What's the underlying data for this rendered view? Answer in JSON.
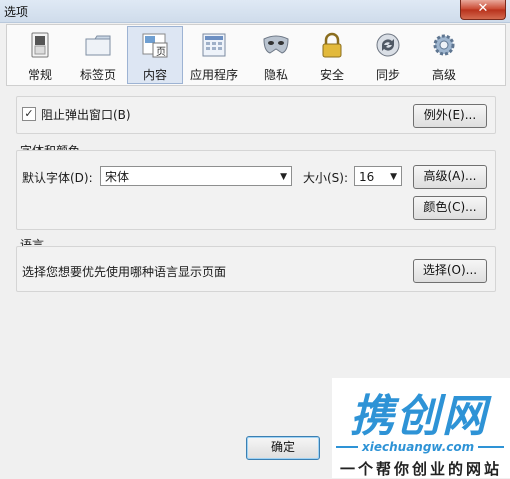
{
  "window": {
    "title": "选项",
    "close_label": "✕"
  },
  "tabs": [
    {
      "label": "常规",
      "icon": "switch-icon"
    },
    {
      "label": "标签页",
      "icon": "folder-tab-icon"
    },
    {
      "label": "内容",
      "icon": "page-content-icon",
      "active": true,
      "icon_text": "页"
    },
    {
      "label": "应用程序",
      "icon": "applications-icon"
    },
    {
      "label": "隐私",
      "icon": "mask-icon"
    },
    {
      "label": "安全",
      "icon": "padlock-icon"
    },
    {
      "label": "同步",
      "icon": "sync-icon"
    },
    {
      "label": "高级",
      "icon": "gear-icon"
    }
  ],
  "popup": {
    "checkbox_label": "阻止弹出窗口(B)",
    "checked": true,
    "exceptions_button": "例外(E)..."
  },
  "fonts": {
    "group_title": "字体和颜色",
    "default_font_label": "默认字体(D):",
    "default_font_value": "宋体",
    "size_label": "大小(S):",
    "size_value": "16",
    "advanced_button": "高级(A)...",
    "colors_button": "颜色(C)..."
  },
  "language": {
    "group_title": "语言",
    "description": "选择您想要优先使用哪种语言显示页面",
    "choose_button": "选择(O)..."
  },
  "footer": {
    "ok_button": "确定"
  },
  "watermark": {
    "logo": "携创网",
    "url": "xiechuangw.com",
    "slogan": "一个帮你创业的网站"
  }
}
